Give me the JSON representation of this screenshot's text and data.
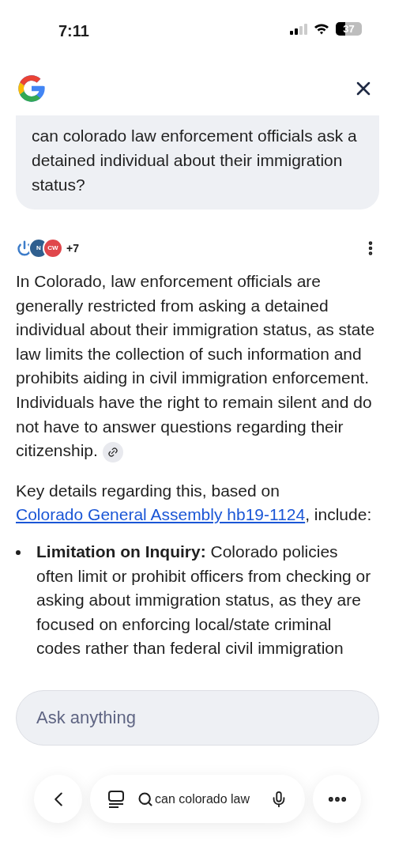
{
  "status_bar": {
    "time": "7:11",
    "battery": "37"
  },
  "query": "can colorado law enforcement officials ask a detained individual about their immigration status?",
  "sources": {
    "logos": [
      {
        "kind": "power"
      },
      {
        "kind": "text",
        "text": "N"
      },
      {
        "kind": "text",
        "text": "CW"
      }
    ],
    "more": "+7"
  },
  "answer": "In Colorado, law enforcement officials are generally restricted from asking a detained individual about their immigration status, as state law limits the collection of such information and prohibits aiding in civil immigration enforcement. Individuals have the right to remain silent and do not have to answer questions regarding their citizenship.",
  "key_details": {
    "before": "Key details regarding this, based on ",
    "link": "Colorado General Assembly hb19-1124",
    "after": ", include:"
  },
  "bullets": [
    "**Limitation on Inquiry:** Colorado policies often limit or prohibit officers from checking or asking about immigration status, as they are focused on enforcing local/state criminal codes rather than federal civil immigration"
  ],
  "ask": {
    "placeholder": "Ask anything"
  },
  "bottom_bar": {
    "search": "can colorado law"
  }
}
